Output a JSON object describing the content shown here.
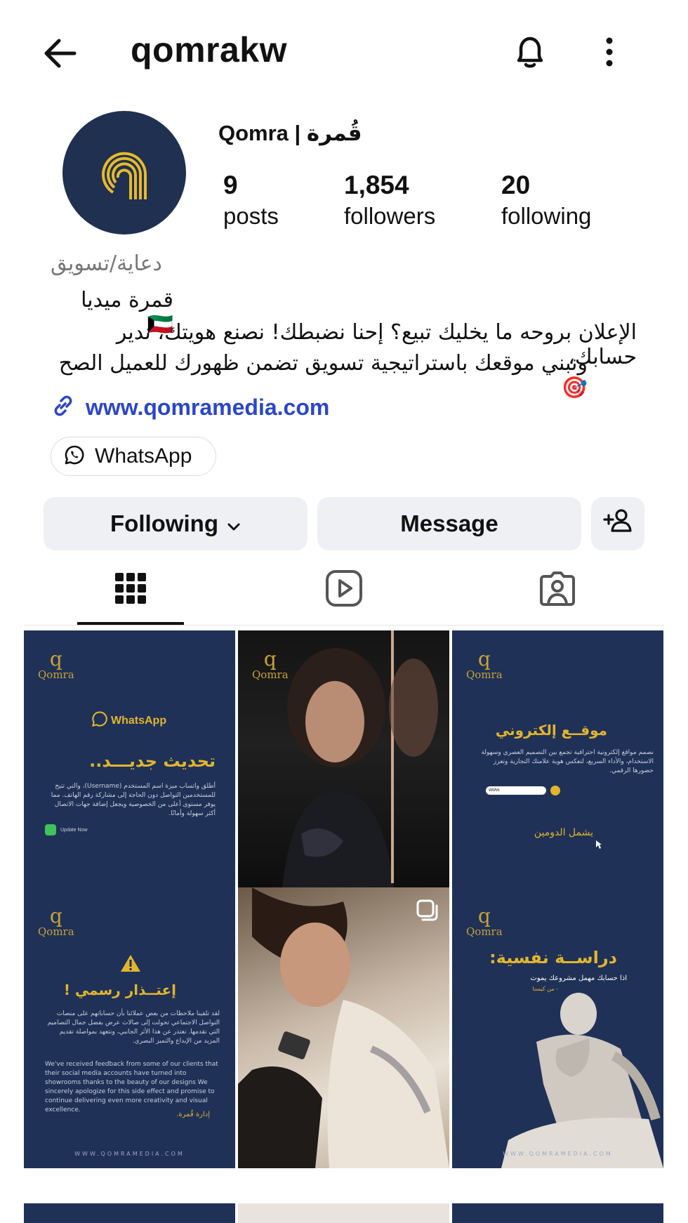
{
  "header": {
    "username": "qomrakw"
  },
  "profile": {
    "display_name": "Qomra | قُمرة",
    "stats": [
      {
        "value": "9",
        "label": "posts"
      },
      {
        "value": "1,854",
        "label": "followers"
      },
      {
        "value": "20",
        "label": "following"
      }
    ],
    "category": "دعاية/تسويق",
    "bio_name": "قمرة ميديا 🇰🇼",
    "bio_line1": "الإعلان بروحه ما يخليك تبيع؟ إحنا نضبطك! نصنع هويتك، ندير حسابك،",
    "bio_line2": "ونبني موقعك باستراتيجية تسويق تضمن ظهورك للعميل الصح 🎯",
    "website": "www.qomramedia.com",
    "whatsapp_label": "WhatsApp"
  },
  "actions": {
    "following_label": "Following",
    "message_label": "Message"
  },
  "posts": {
    "p1": {
      "brand": "WhatsApp",
      "title": "تحديث جديـــد..",
      "body": "أطلق واتساب ميزة اسم المستخدم (Username)، والتي تتيح للمستخدمين التواصل دون الحاجة إلى مشاركة رقم الهاتف. مما يوفر مستوى أعلى من الخصوصية ويجعل إضافة جهات الاتصال أكثر سهولة وأمانًا.",
      "update_label": "Update Now"
    },
    "p3": {
      "title": "موقــع إلكتروني",
      "body": "نصمم مواقع إلكترونية احترافية تجمع بين التصميم العصري وسهولة الاستخدام، والأداء السريع، لتعكس هوية علامتك التجارية وتعزز حضورها الرقمي.",
      "url_prefix": "www.",
      "subtitle": "يشمل الدومين"
    },
    "p4": {
      "title": "إعتــذار رسمي !",
      "body_ar": "لقد تلقينا ملاحظات من بعض عملائنا بأن حساباتهم على منصات التواصل الاجتماعي تحولت إلى صالات عرض بفضل جمال التصاميم التي نقدمها. نعتذر عن هذا الأثر الجانبي، ونتعهد بمواصلة تقديم المزيد من الإبداع والتميز البصري.",
      "body_en": "We've received feedback from some of our clients that their social media accounts have turned into showrooms thanks to the beauty of our designs We sincerely apologize for this side effect and promise to continue delivering even more creativity and visual excellence.",
      "sign": "إدارة قُمرة."
    },
    "p6": {
      "title": "دراســة نفسية:",
      "subtitle": "اذا حسابك مهمل مشروعك يموت",
      "sign": "- من كيسنا"
    },
    "logo_text": "Qomra",
    "logo_letter": "q",
    "footer": "WWW.QOMRAMEDIA.COM"
  },
  "colors": {
    "navy": "#1f3157",
    "gold": "#e2b52c",
    "link": "#2b46c8"
  }
}
